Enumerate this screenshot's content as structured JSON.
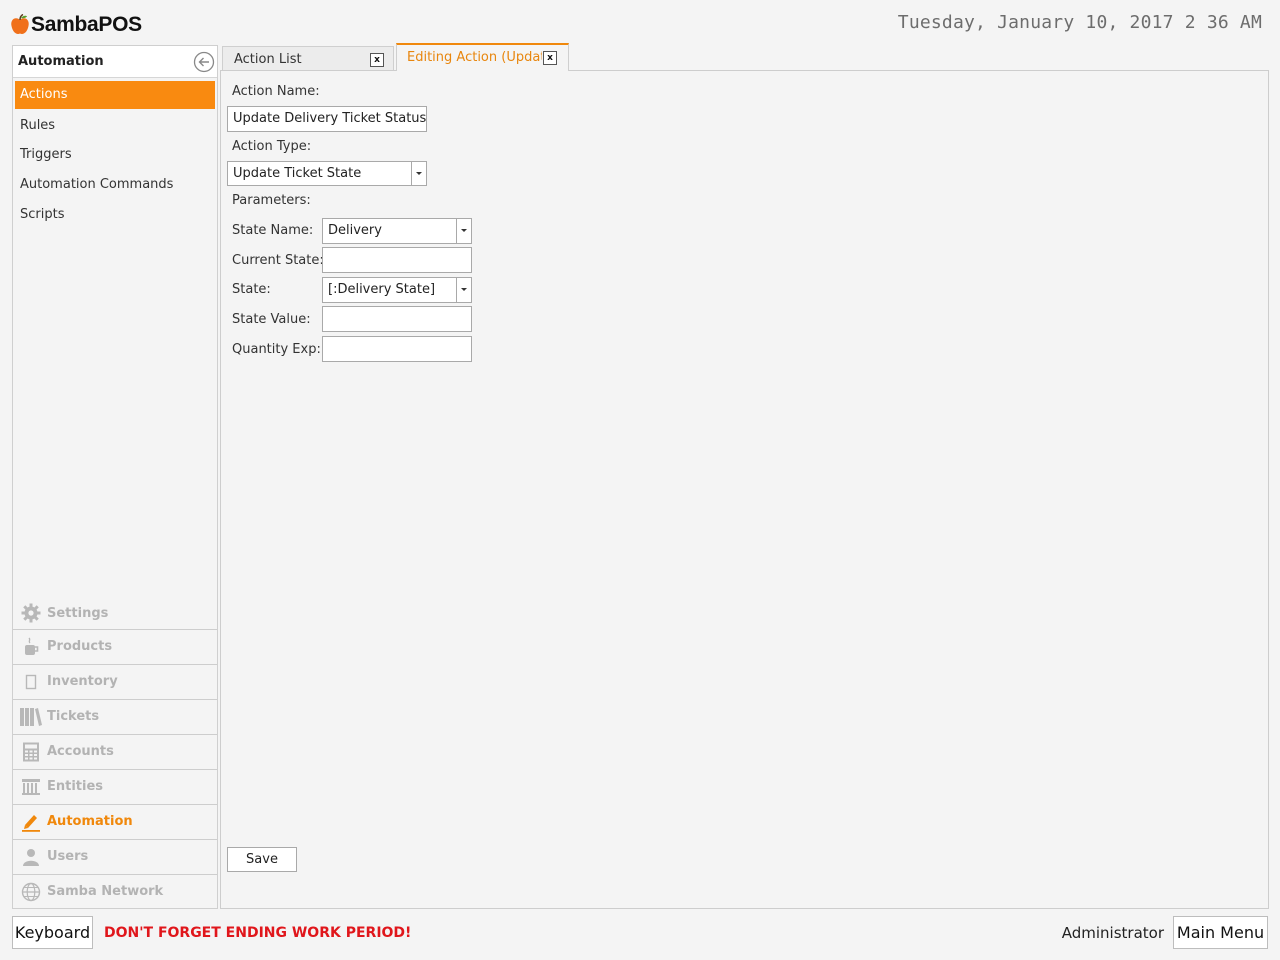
{
  "app": {
    "brand": "SambaPOS"
  },
  "header": {
    "datetime": "Tuesday, January 10, 2017 2 36 AM"
  },
  "sidebar": {
    "title": "Automation",
    "items": [
      {
        "label": "Actions",
        "active": true
      },
      {
        "label": "Rules"
      },
      {
        "label": "Triggers"
      },
      {
        "label": "Automation Commands"
      },
      {
        "label": "Scripts"
      }
    ],
    "modules": [
      {
        "label": "Settings",
        "icon": "gear-icon"
      },
      {
        "label": "Products",
        "icon": "cup-icon"
      },
      {
        "label": "Inventory",
        "icon": "box-icon"
      },
      {
        "label": "Tickets",
        "icon": "books-icon"
      },
      {
        "label": "Accounts",
        "icon": "calculator-icon"
      },
      {
        "label": "Entities",
        "icon": "table-icon"
      },
      {
        "label": "Automation",
        "icon": "pencil-icon",
        "active": true
      },
      {
        "label": "Users",
        "icon": "user-icon"
      },
      {
        "label": "Samba Network",
        "icon": "globe-icon"
      }
    ]
  },
  "tabs": [
    {
      "label": "Action List",
      "close": "x"
    },
    {
      "label": "Editing Action (Update Delivery Ticket Status)",
      "close": "x",
      "active": true
    }
  ],
  "form": {
    "action_name_label": "Action Name:",
    "action_name_value": "Update Delivery Ticket Status",
    "action_type_label": "Action Type:",
    "action_type_value": "Update Ticket State",
    "parameters_label": "Parameters:",
    "params": {
      "state_name_label": "State Name:",
      "state_name_value": "Delivery",
      "current_state_label": "Current State:",
      "current_state_value": "",
      "state_label": "State:",
      "state_value": "[:Delivery State]",
      "state_value_label": "State Value:",
      "state_value_value": "",
      "quantity_exp_label": "Quantity Exp:",
      "quantity_exp_value": ""
    },
    "save_label": "Save"
  },
  "footer": {
    "keyboard_label": "Keyboard",
    "warning": "DON'T FORGET ENDING WORK PERIOD!",
    "user": "Administrator",
    "main_menu_label": "Main Menu"
  },
  "colors": {
    "accent": "#f98a10",
    "warning": "#e0161b",
    "inactive_module": "#b3b3b3"
  }
}
